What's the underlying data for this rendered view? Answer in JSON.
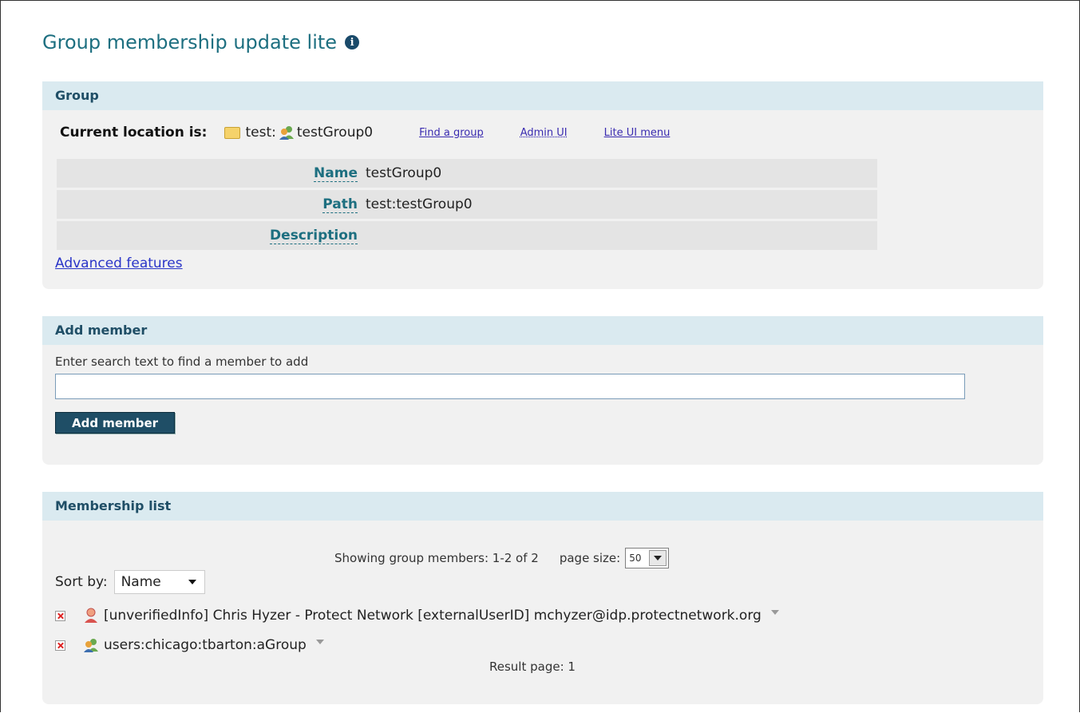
{
  "page": {
    "title": "Group membership update lite"
  },
  "group_panel": {
    "heading": "Group",
    "current_location_label": "Current location is:",
    "folder_name": "test:",
    "group_name": "testGroup0",
    "links": {
      "find_group": "Find a group",
      "admin_ui": "Admin UI",
      "lite_ui_menu": "Lite UI menu"
    },
    "attributes": [
      {
        "label": "Name",
        "value": "testGroup0"
      },
      {
        "label": "Path",
        "value": "test:testGroup0"
      },
      {
        "label": "Description",
        "value": ""
      }
    ],
    "advanced_features": "Advanced features"
  },
  "add_member_panel": {
    "heading": "Add member",
    "hint": "Enter search text to find a member to add",
    "search_value": "",
    "button_label": "Add member"
  },
  "membership_panel": {
    "heading": "Membership list",
    "showing": "Showing group members: 1-2 of 2",
    "page_size_label": "page size:",
    "page_size_value": "50",
    "sort_by_label": "Sort by:",
    "sort_by_value": "Name",
    "members": [
      {
        "type": "person",
        "label": "[unverifiedInfo] Chris Hyzer - Protect Network [externalUserID] mchyzer@idp.protectnetwork.org"
      },
      {
        "type": "group",
        "label": "users:chicago:tbarton:aGroup"
      }
    ],
    "result_page": "Result page: 1"
  },
  "colors": {
    "accent": "#1d6f80",
    "panel_header": "#daeaf0",
    "panel_bg": "#f1f1f1",
    "button": "#1f4e66"
  }
}
